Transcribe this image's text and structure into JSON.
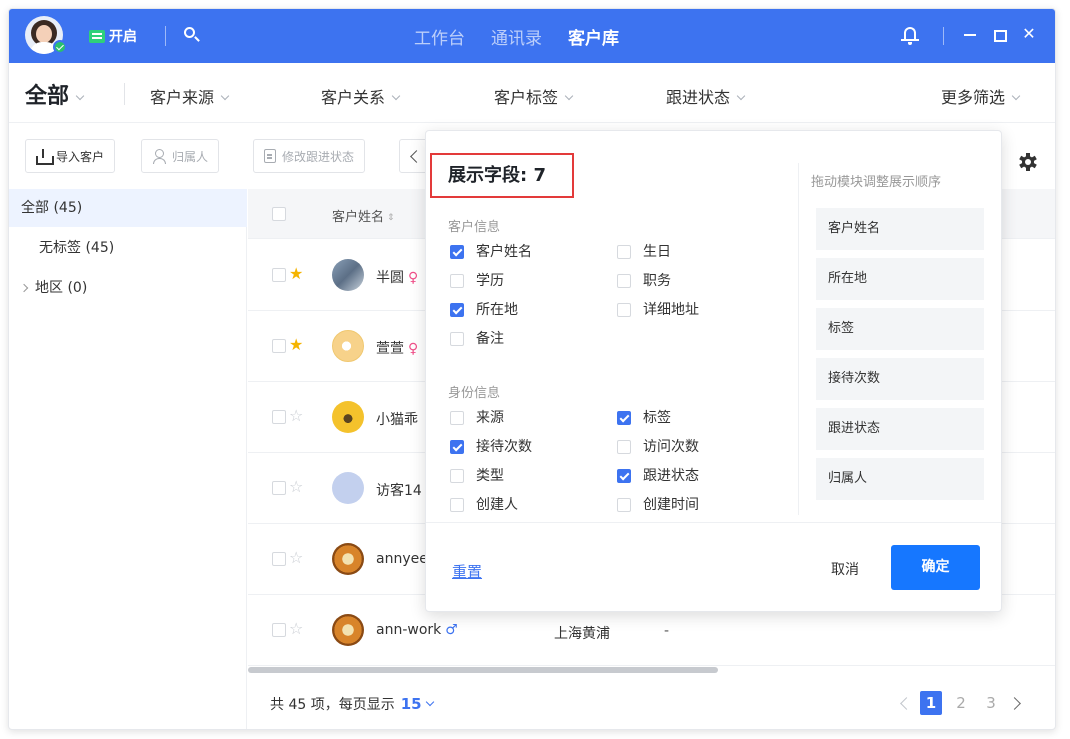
{
  "titlebar": {
    "status_label": "开启",
    "tabs": [
      {
        "label": "工作台",
        "active": false
      },
      {
        "label": "通讯录",
        "active": false
      },
      {
        "label": "客户库",
        "active": true
      }
    ],
    "accent_color": "#3d73f0"
  },
  "filters": {
    "all_label": "全部",
    "items": [
      "客户来源",
      "客户关系",
      "客户标签",
      "跟进状态",
      "更多筛选"
    ]
  },
  "toolbar": {
    "import_label": "导入客户",
    "owner_label": "归属人",
    "status_label": "修改跟进状态"
  },
  "sidebar": {
    "items": [
      {
        "label": "全部 (45)",
        "active": true
      },
      {
        "label": "无标签 (45)",
        "active": false
      },
      {
        "label": "地区 (0)",
        "active": false
      }
    ]
  },
  "table": {
    "header_name": "客户姓名",
    "rows": [
      {
        "name": "半圆",
        "gender": "♀",
        "starred": true,
        "location": "",
        "value": ""
      },
      {
        "name": "萱萱",
        "gender": "♀",
        "starred": true,
        "location": "",
        "value": ""
      },
      {
        "name": "小猫乖",
        "gender": "",
        "starred": false,
        "location": "",
        "value": ""
      },
      {
        "name": "访客14",
        "gender": "",
        "starred": false,
        "location": "",
        "value": ""
      },
      {
        "name": "annyee",
        "gender": "",
        "starred": false,
        "location": "",
        "value": ""
      },
      {
        "name": "ann-work",
        "gender": "♂",
        "starred": false,
        "location": "上海黄浦",
        "value": "-"
      }
    ]
  },
  "footer": {
    "total_text": "共 45 项，每页显示",
    "page_size": "15",
    "pages": [
      "1",
      "2",
      "3"
    ],
    "current_page": "1"
  },
  "popup": {
    "title": "展示字段: 7",
    "customer_group": "客户信息",
    "identity_group": "身份信息",
    "customer_options": [
      {
        "label": "客户姓名",
        "checked": true
      },
      {
        "label": "生日",
        "checked": false
      },
      {
        "label": "学历",
        "checked": false
      },
      {
        "label": "职务",
        "checked": false
      },
      {
        "label": "所在地",
        "checked": true
      },
      {
        "label": "详细地址",
        "checked": false
      },
      {
        "label": "备注",
        "checked": false
      }
    ],
    "identity_options": [
      {
        "label": "来源",
        "checked": false
      },
      {
        "label": "标签",
        "checked": true
      },
      {
        "label": "接待次数",
        "checked": true
      },
      {
        "label": "访问次数",
        "checked": false
      },
      {
        "label": "类型",
        "checked": false
      },
      {
        "label": "跟进状态",
        "checked": true
      },
      {
        "label": "创建人",
        "checked": false
      },
      {
        "label": "创建时间",
        "checked": false
      }
    ],
    "order_hint": "拖动模块调整展示顺序",
    "order_items": [
      "客户姓名",
      "所在地",
      "标签",
      "接待次数",
      "跟进状态",
      "归属人"
    ],
    "reset_label": "重置",
    "cancel_label": "取消",
    "confirm_label": "确定"
  }
}
